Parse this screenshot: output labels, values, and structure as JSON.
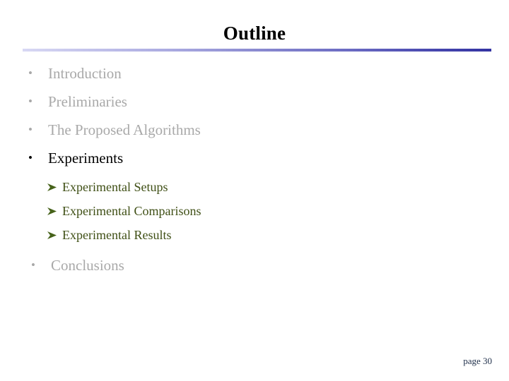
{
  "slide": {
    "title": "Outline",
    "page_label": "page 30",
    "accent_color_start": "#d8d8f4",
    "accent_color_end": "#3333a2",
    "dim_color": "#a9a9a9",
    "active_color": "#000000",
    "sub_color": "#3f4f15"
  },
  "outline": {
    "items": [
      {
        "label": "Introduction",
        "state": "dim"
      },
      {
        "label": "Preliminaries",
        "state": "dim"
      },
      {
        "label": "The Proposed Algorithms",
        "state": "dim"
      },
      {
        "label": "Experiments",
        "state": "active"
      },
      {
        "label": "Conclusions",
        "state": "dim"
      }
    ],
    "sub_items": [
      {
        "label": "Experimental Setups",
        "marker": "arrowhead-right-icon"
      },
      {
        "label": "Experimental Comparisons",
        "marker": "arrowhead-right-icon"
      },
      {
        "label": "Experimental Results",
        "marker": "arrowhead-right-icon"
      }
    ],
    "bullet_glyph": "•"
  }
}
